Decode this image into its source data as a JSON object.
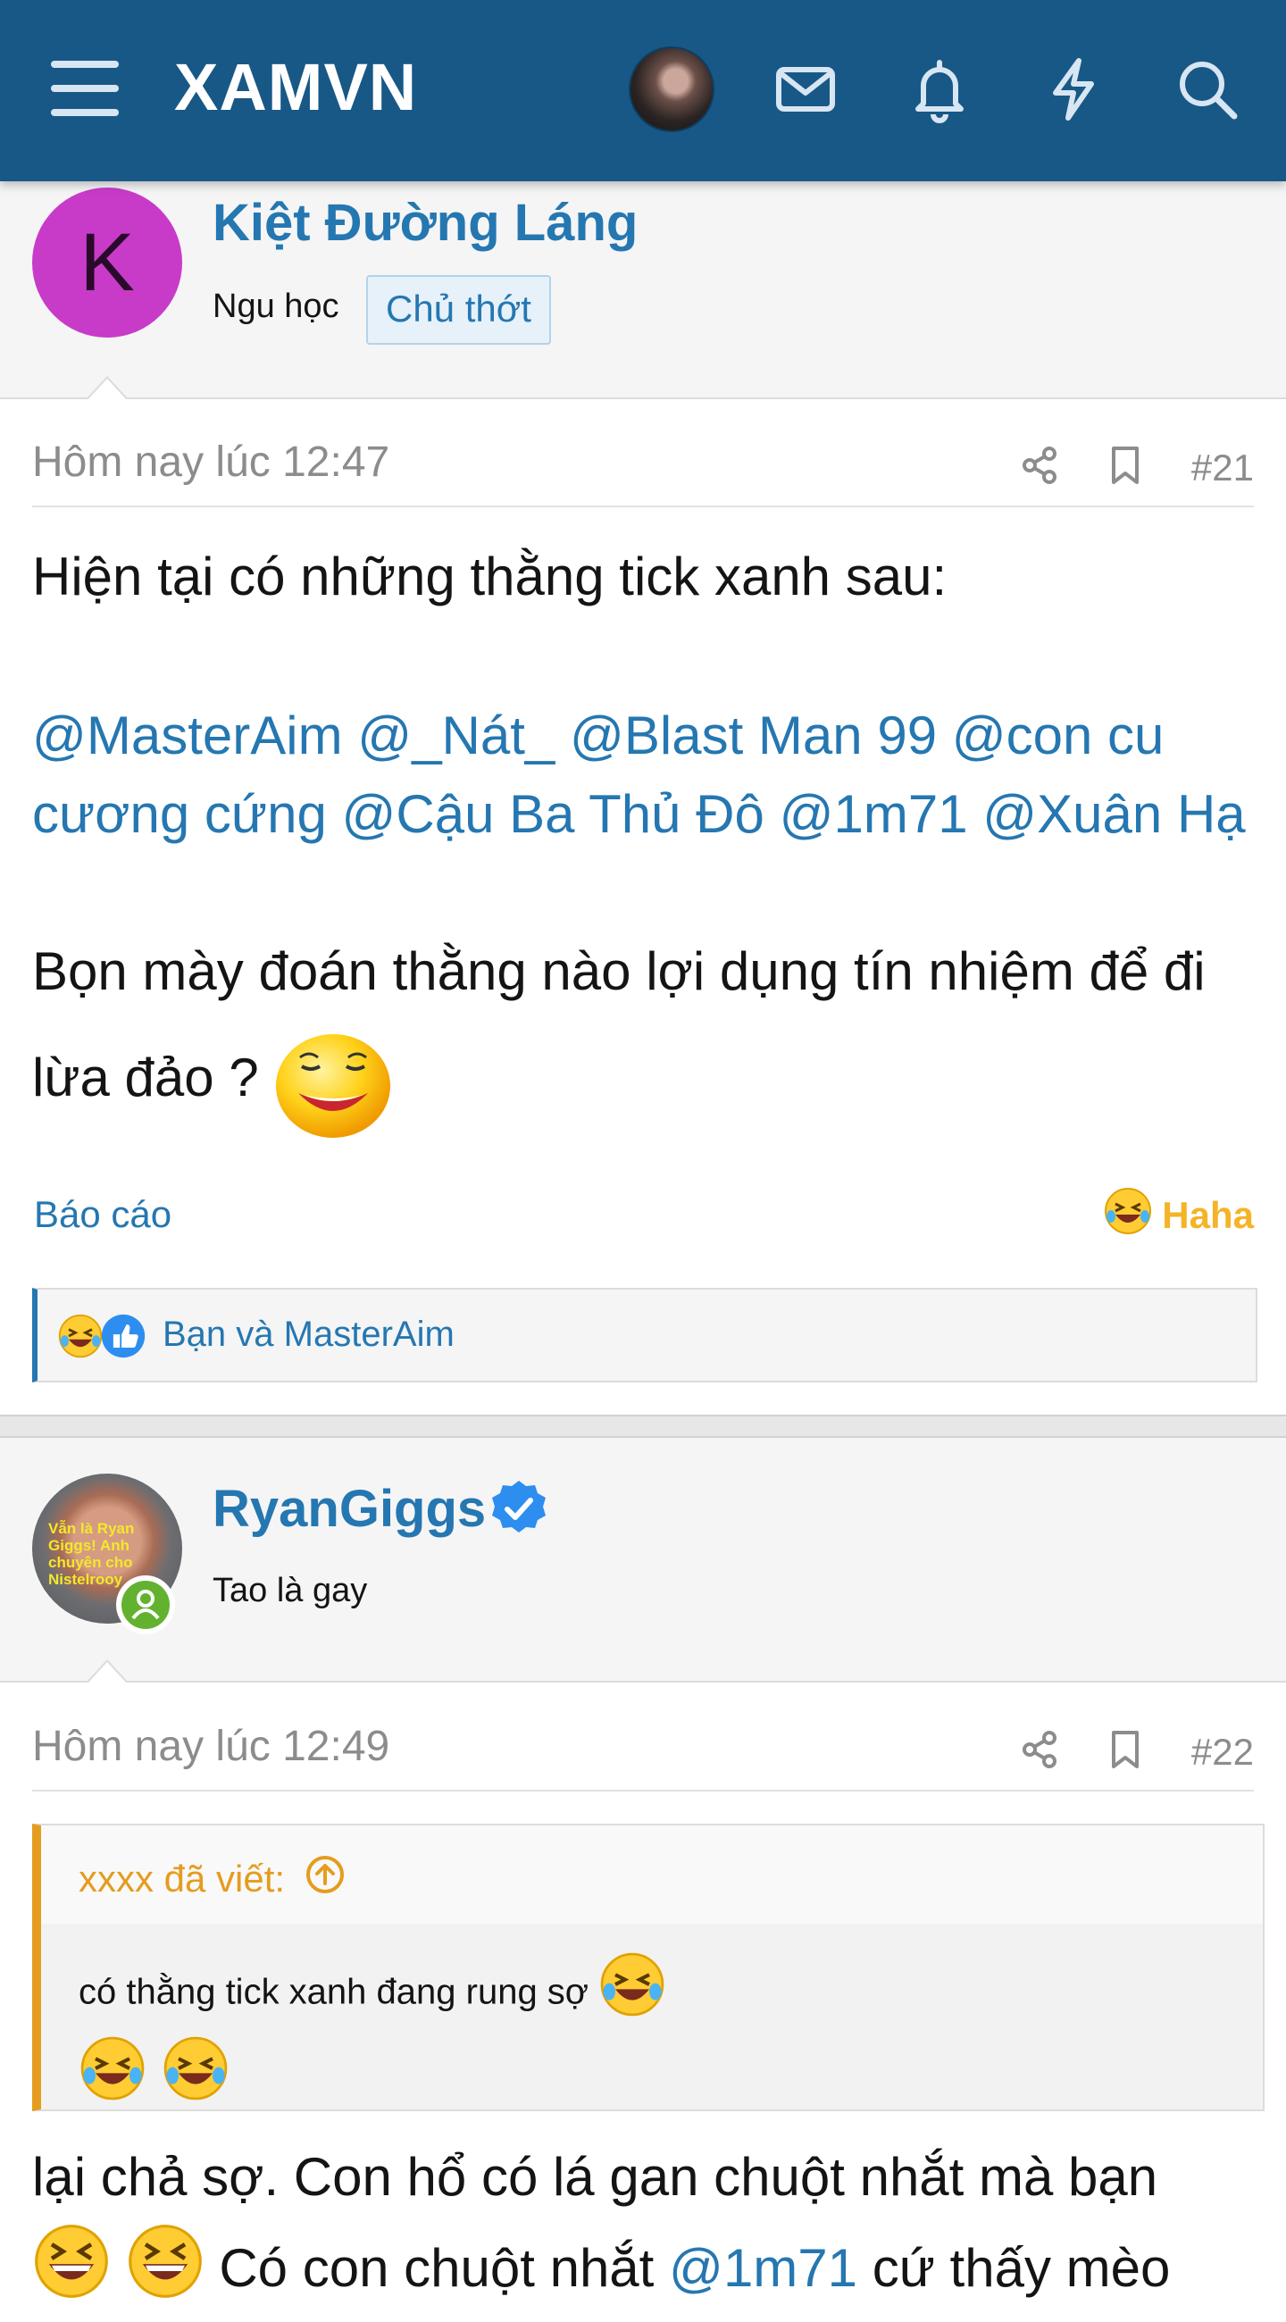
{
  "header": {
    "logo": "XAMVN",
    "icons": [
      "menu-icon",
      "avatar",
      "mail-icon",
      "bell-icon",
      "bolt-icon",
      "search-icon"
    ]
  },
  "post21": {
    "author": "Kiệt Đường Láng",
    "avatar_letter": "K",
    "user_title": "Ngu học",
    "badge": "Chủ thớt",
    "date": "Hôm nay lúc 12:47",
    "number": "#21",
    "line1": "Hiện tại có những thằng tick xanh sau:",
    "mentions": [
      "@MasterAim",
      "@_Nát_",
      "@Blast Man 99",
      "@con cu",
      "cương cứng",
      "@Cậu Ba Thủ Đô",
      "@1m71",
      "@Xuân Hạ"
    ],
    "line2": "Bọn mày đoán thằng nào lợi dụng tín nhiệm để đi",
    "line3": "lừa đảo ?",
    "report": "Báo cáo",
    "reaction_label": "Haha",
    "reactions_text": "Bạn và MasterAim"
  },
  "post22": {
    "author": "RyanGiggs",
    "avatar_overlay": "Vẫn là Ryan Giggs! Anh chuyên cho Nistelrooy",
    "user_title": "Tao là gay",
    "date": "Hôm nay lúc 12:49",
    "number": "#22",
    "quote_author": "xxxx đã viết:",
    "quote_text": "có thằng tick xanh đang rung sợ",
    "body_line1": "lại chả sợ. Con hổ có lá gan chuột nhắt mà bạn",
    "body_line2_a": "Có con chuột nhắt",
    "body_line2_mention": "@1m71",
    "body_line2_b": "cứ thấy mèo"
  },
  "colors": {
    "topbar": "#185886",
    "link": "#2577b1",
    "quote_accent": "#e59c1f",
    "haha": "#f5b327"
  }
}
